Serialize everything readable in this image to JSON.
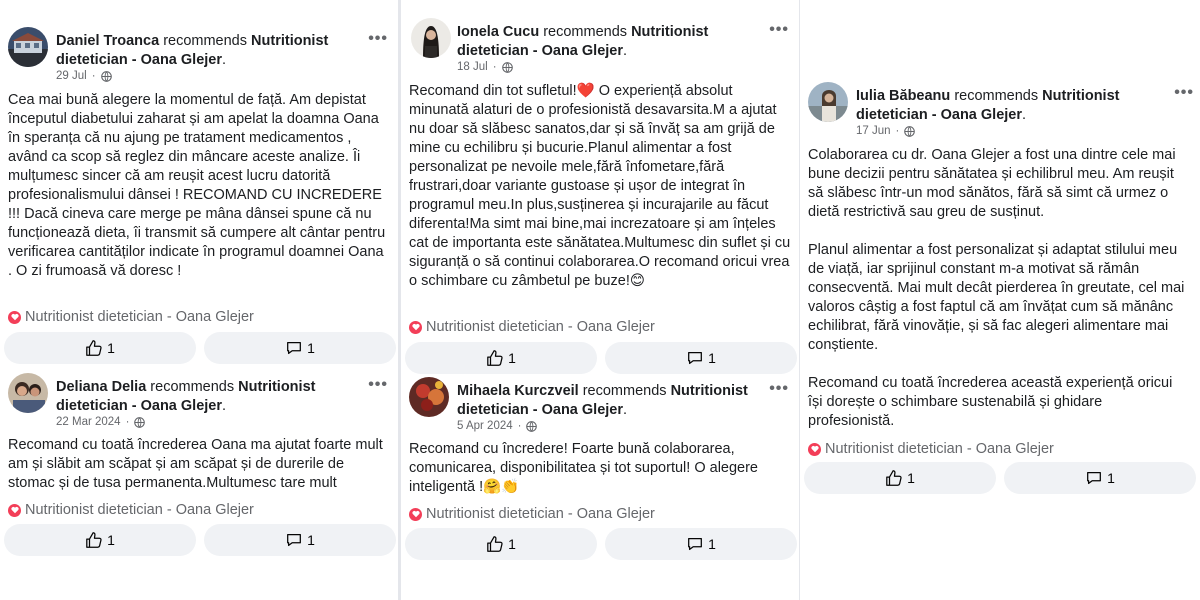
{
  "reviews": [
    {
      "name": "Daniel Troanca",
      "verb": "recommends",
      "page": "Nutritionist dietetician - Oana Glejer",
      "date": "29 Jul",
      "text": "Cea mai bună alegere la momentul de față. Am depistat începutul diabetului zaharat și am apelat la doamna Oana în speranța că nu ajung pe tratament medicamentos , având ca scop să reglez din mâncare aceste analize. Îi mulțumesc sincer că am reușit acest lucru datorită profesionalismului dânsei  ! RECOMAND CU INCREDERE  !!! Dacă cineva care merge pe mâna dânsei spune că nu funcționează dieta, îi transmit să cumpere alt cântar pentru verificarea cantităților indicate în programul doamnei Oana . O zi frumoasă vă doresc !",
      "tag": "Nutritionist dietetician - Oana Glejer",
      "likes": "1",
      "comments": "1"
    },
    {
      "name": "Deliana Delia",
      "verb": "recommends",
      "page": "Nutritionist dietetician - Oana Glejer",
      "date": "22 Mar 2024",
      "text": "Recomand cu toată încrederea Oana ma ajutat foarte mult am și slăbit am scăpat și am scăpat și de durerile de stomac și de tusa permanenta.Multumesc tare mult",
      "tag": "Nutritionist dietetician - Oana Glejer",
      "likes": "1",
      "comments": "1"
    },
    {
      "name": "Ionela Cucu",
      "verb": "recommends",
      "page": "Nutritionist dietetician - Oana Glejer",
      "date": "18 Jul",
      "text_a": "Recomand din tot sufletul!",
      "emoji_a": "❤️",
      "text_b": " O experiență absolut minunată alaturi de o profesionistă desavarsita.M a ajutat nu doar să slăbesc sanatos,dar și să învăț sa am grijă de mine cu echilibru și bucurie.Planul alimentar a fost personalizat pe nevoile mele,fără înfometare,fără frustrari,doar variante gustoase și ușor de integrat în programul meu.In plus,susținerea și incurajarile au făcut diferenta!Ma simt mai bine,mai increzatoare și am înțeles cat de importanta este sănătatea.Multumesc din suflet și cu siguranță o să continui colaborarea.O recomand oricui vrea o schimbare cu zâmbetul pe buze!",
      "emoji_b": "😊",
      "tag": "Nutritionist dietetician - Oana Glejer",
      "likes": "1",
      "comments": "1"
    },
    {
      "name": "Mihaela Kurczveil",
      "verb": "recommends",
      "page": "Nutritionist dietetician - Oana Glejer",
      "date": "5 Apr 2024",
      "text": "Recomand cu încredere! Foarte bună colaborarea, comunicarea, disponibilitatea și tot suportul! O alegere inteligentă !",
      "emoji": "🤗👏",
      "tag": "Nutritionist dietetician - Oana Glejer",
      "likes": "1",
      "comments": "1"
    },
    {
      "name": "Iulia Băbeanu",
      "verb": "recommends",
      "page": "Nutritionist dietetician - Oana Glejer",
      "date": "17 Jun",
      "text": "Colaborarea cu dr. Oana Glejer a fost una dintre cele mai bune decizii pentru sănătatea și echilibrul meu. Am reușit să slăbesc într-un mod sănătos, fără să simt că urmez o dietă restrictivă sau greu de susținut.\n\nPlanul alimentar a fost personalizat și adaptat stilului meu de viață, iar sprijinul constant m-a motivat să rămân consecventă. Mai mult decât pierderea în greutate, cel mai valoros câștig a fost faptul că am învățat cum să mănânc echilibrat, fără vinovăție, și să fac alegeri alimentare mai conștiente.\n\nRecomand cu toată încrederea această experiență oricui își dorește o schimbare sustenabilă și ghidare profesionistă.",
      "tag": "Nutritionist dietetician - Oana Glejer",
      "likes": "1",
      "comments": "1"
    }
  ],
  "more_label": "•••",
  "icons": {
    "like": "thumbs-up-icon",
    "comment": "comment-icon",
    "privacy": "globe-icon",
    "recommend": "heart-icon"
  },
  "colors": {
    "button_bg": "#f0f2f5",
    "heart": "#f33e58",
    "muted": "#65676b"
  }
}
